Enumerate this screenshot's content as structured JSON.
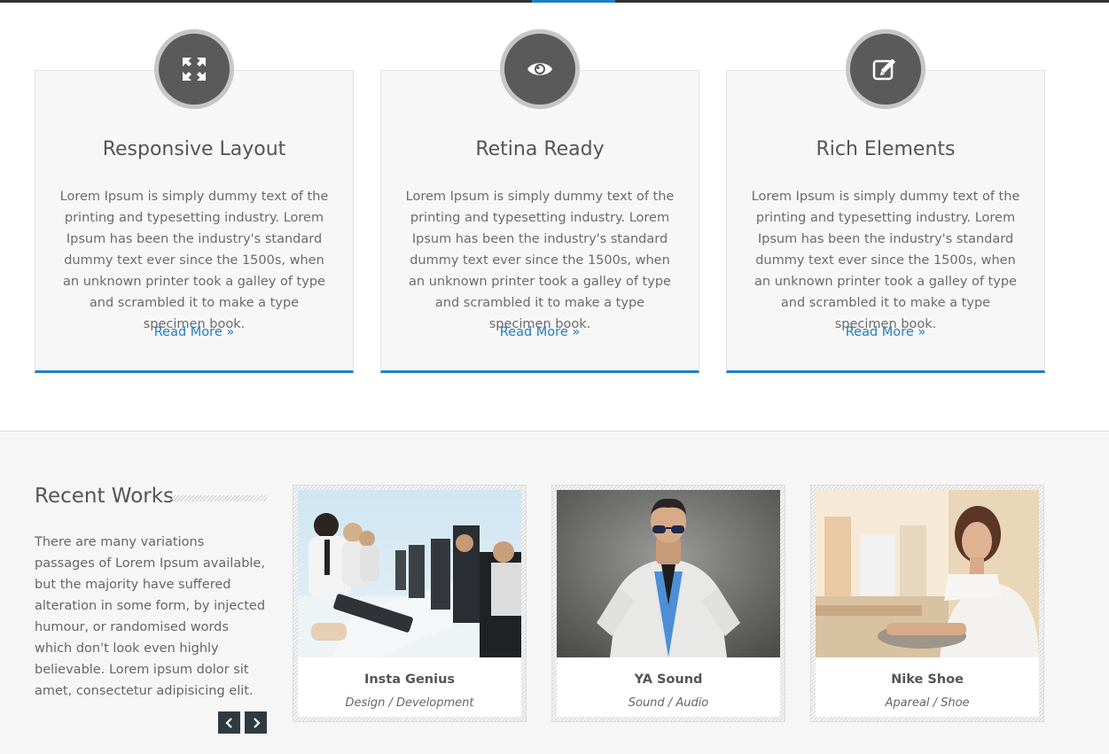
{
  "features": [
    {
      "icon": "expand-arrows-icon",
      "title": "Responsive Layout",
      "text": "Lorem Ipsum is simply dummy text of the printing and typesetting industry. Lorem Ipsum has been the industry's standard dummy text ever since the 1500s, when an unknown printer took a galley of type and scrambled it to make a type specimen book.",
      "link": "Read More »"
    },
    {
      "icon": "eye-icon",
      "title": "Retina Ready",
      "text": "Lorem Ipsum is simply dummy text of the printing and typesetting industry. Lorem Ipsum has been the industry's standard dummy text ever since the 1500s, when an unknown printer took a galley of type and scrambled it to make a type specimen book.",
      "link": "Read More »"
    },
    {
      "icon": "edit-icon",
      "title": "Rich Elements",
      "text": "Lorem Ipsum is simply dummy text of the printing and typesetting industry. Lorem Ipsum has been the industry's standard dummy text ever since the 1500s, when an unknown printer took a galley of type and scrambled it to make a type specimen book.",
      "link": "Read More »"
    }
  ],
  "recent_works": {
    "title": "Recent Works",
    "description": "There are many variations passages of Lorem Ipsum available, but the majority have suffered alteration in some form, by injected humour, or randomised words which don't look even highly believable. Lorem ipsum dolor sit amet, consectetur adipisicing elit.",
    "prev_icon": "chevron-left-icon",
    "next_icon": "chevron-right-icon",
    "items": [
      {
        "name": "Insta Genius",
        "category": "Design / Development"
      },
      {
        "name": "YA Sound",
        "category": "Sound / Audio"
      },
      {
        "name": "Nike Shoe",
        "category": "Apareal / Shoe"
      }
    ]
  },
  "colors": {
    "accent": "#1e7fc2",
    "topbar": "#2f3136",
    "icon_circle": "#5a5a5a",
    "nav_button": "#2f3a40"
  }
}
